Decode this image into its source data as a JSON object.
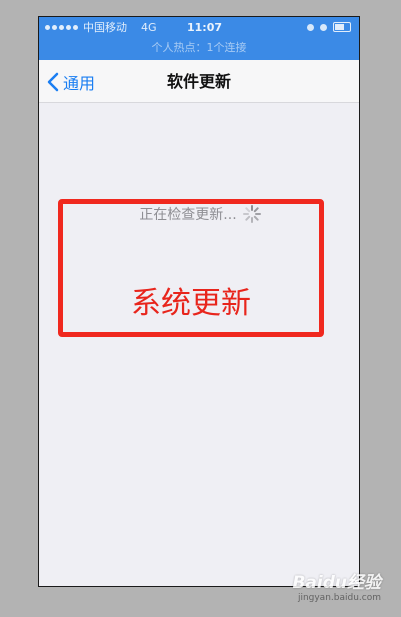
{
  "status_bar": {
    "carrier": "中国移动",
    "network": "4G",
    "time": "11:07",
    "hotspot_text": "个人热点：1个连接",
    "background_color": "#3b8ae6"
  },
  "nav_bar": {
    "back_label": "通用",
    "back_icon": "chevron-left-icon",
    "title": "软件更新",
    "accent_color": "#1a7ef2"
  },
  "content": {
    "checking_label": "正在检查更新...",
    "spinner_icon": "spinner-icon"
  },
  "annotation": {
    "text": "系统更新",
    "color": "#e8251c"
  },
  "watermark": {
    "logo_text": "Baidu经验",
    "url": "jingyan.baidu.com"
  }
}
